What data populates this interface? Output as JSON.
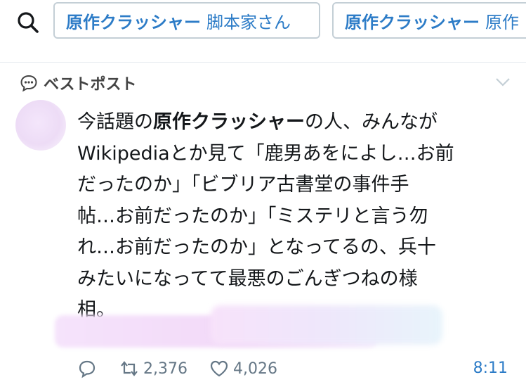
{
  "search": {
    "chips": [
      {
        "strong": "原作クラッシャー",
        "rest": "脚本家さん"
      },
      {
        "strong": "原作クラッシャー",
        "rest": "原作"
      }
    ]
  },
  "section": {
    "label": "ベストポスト"
  },
  "tweet": {
    "lines": [
      {
        "pre": "今話題の",
        "strong": "原作クラッシャー",
        "post": "の人、みんなが"
      },
      {
        "text": "Wikipediaとか見て「鹿男あをによし…お前"
      },
      {
        "text": "だったのか」「ビブリア古書堂の事件手"
      },
      {
        "text": "帖…お前だったのか」「ミステリと言う勿"
      },
      {
        "text": "れ…お前だったのか」となってるの、兵十"
      },
      {
        "text": "みたいになってて最悪のごんぎつねの様"
      },
      {
        "text": "相。"
      }
    ]
  },
  "actions": {
    "retweets": "2,376",
    "likes": "4,026",
    "time": "8:11"
  }
}
